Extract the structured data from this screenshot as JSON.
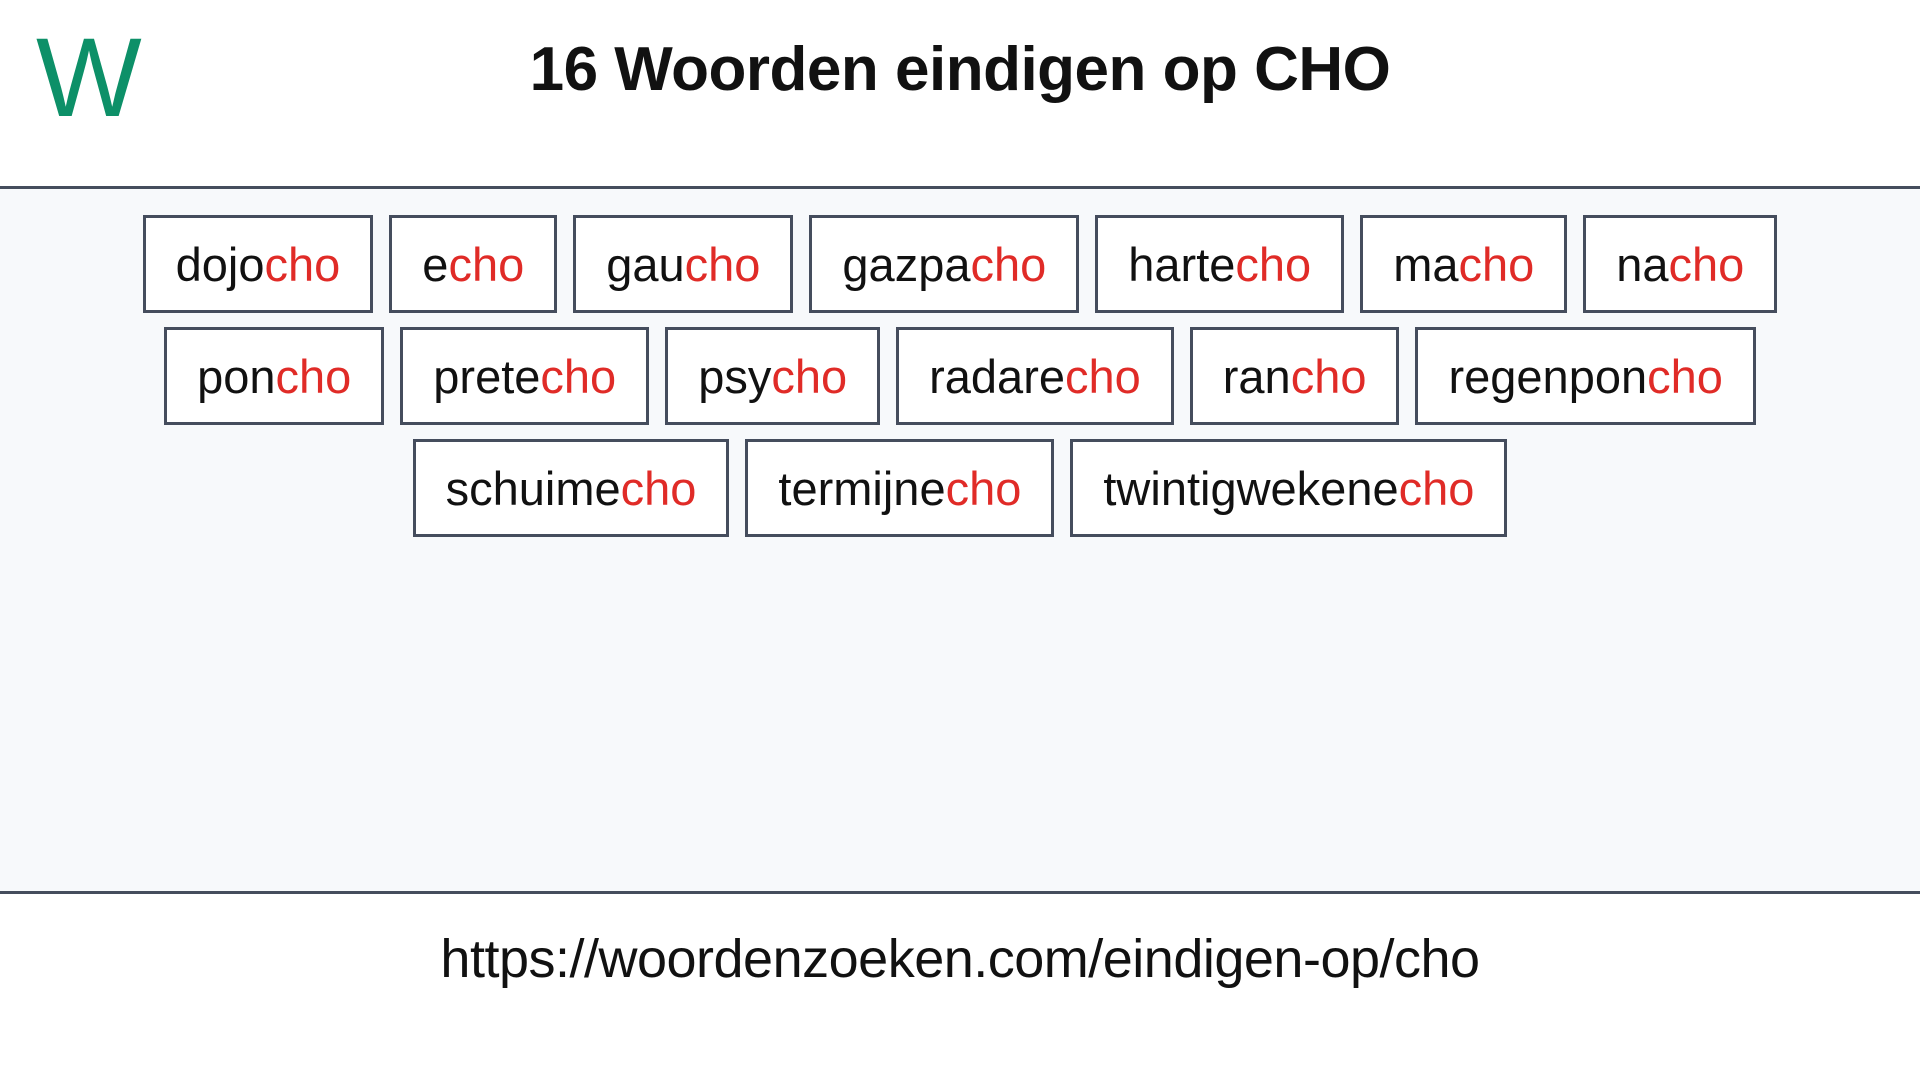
{
  "header": {
    "logo_text": "W",
    "logo_color": "#0d9068",
    "title": "16 Woorden eindigen op CHO"
  },
  "theme": {
    "content_background": "#f7f9fb",
    "border_color": "#454d5d",
    "suffix_color": "#e02b27",
    "text_color": "#111111"
  },
  "word_list": {
    "count": 16,
    "highlight_suffix": "cho",
    "rows": [
      [
        {
          "prefix": "dojo",
          "suffix": "cho"
        },
        {
          "prefix": "e",
          "suffix": "cho"
        },
        {
          "prefix": "gau",
          "suffix": "cho"
        },
        {
          "prefix": "gazpa",
          "suffix": "cho"
        },
        {
          "prefix": "harte",
          "suffix": "cho"
        },
        {
          "prefix": "ma",
          "suffix": "cho"
        },
        {
          "prefix": "na",
          "suffix": "cho"
        }
      ],
      [
        {
          "prefix": "pon",
          "suffix": "cho"
        },
        {
          "prefix": "prete",
          "suffix": "cho"
        },
        {
          "prefix": "psy",
          "suffix": "cho"
        },
        {
          "prefix": "radare",
          "suffix": "cho"
        },
        {
          "prefix": "ran",
          "suffix": "cho"
        },
        {
          "prefix": "regenpon",
          "suffix": "cho"
        }
      ],
      [
        {
          "prefix": "schuime",
          "suffix": "cho"
        },
        {
          "prefix": "termijne",
          "suffix": "cho"
        },
        {
          "prefix": "twintigwekene",
          "suffix": "cho"
        }
      ]
    ]
  },
  "footer": {
    "url": "https://woordenzoeken.com/eindigen-op/cho"
  }
}
